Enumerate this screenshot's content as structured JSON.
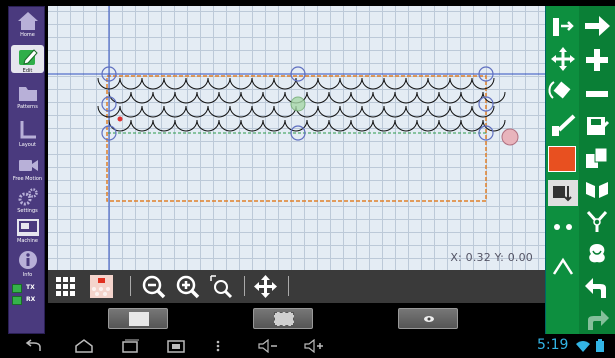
{
  "sidebar": {
    "items": [
      {
        "label": "Home",
        "icon": "home-icon"
      },
      {
        "label": "Edit",
        "icon": "edit-icon",
        "active": true
      },
      {
        "label": "Patterns",
        "icon": "folder-icon"
      },
      {
        "label": "Layout",
        "icon": "layout-icon"
      },
      {
        "label": "Free Motion",
        "icon": "video-icon"
      },
      {
        "label": "Settings",
        "icon": "gears-icon"
      },
      {
        "label": "Machine",
        "icon": "machine-icon"
      },
      {
        "label": "Info",
        "icon": "info-icon"
      }
    ],
    "tx_label": "TX",
    "rx_label": "RX"
  },
  "canvas": {
    "coord_readout": "X: 0.32 Y: 0.00"
  },
  "system_bar": {
    "time": "5:19"
  },
  "colors": {
    "sidebar_bg": "#4a3a7e",
    "right_bar_bg": "#0d8f3f",
    "canvas_bg": "#e4ecf4",
    "boundary_orange": "#e0802a",
    "clock_blue": "#33b5e5"
  }
}
